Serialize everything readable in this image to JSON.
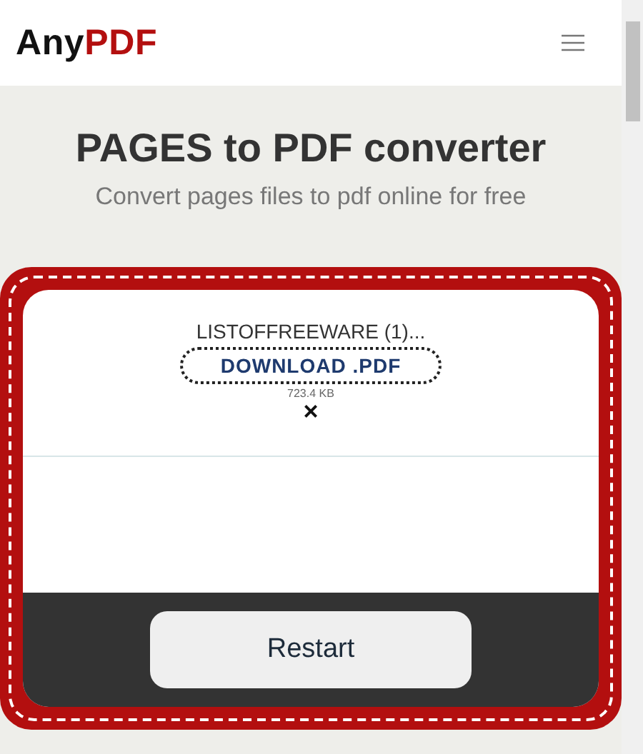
{
  "header": {
    "logo": {
      "part_1": "Any",
      "part_2": "PDF"
    }
  },
  "hero": {
    "title": "PAGES to PDF converter",
    "subtitle": "Convert pages files to pdf online for free"
  },
  "file": {
    "name": "LISTOFFREEWARE (1)...",
    "download": "DOWNLOAD .PDF",
    "size": "723.4 KB",
    "remove": "×"
  },
  "actions": {
    "restart": "Restart"
  }
}
